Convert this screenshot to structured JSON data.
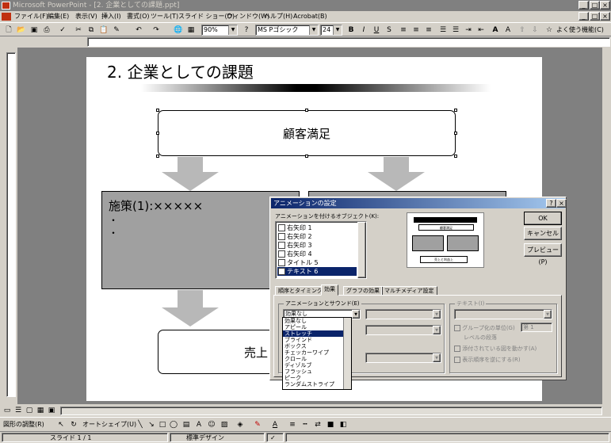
{
  "window": {
    "title": "Microsoft PowerPoint - [2. 企業としての課題.ppt]"
  },
  "menu": [
    "ファイル(F)",
    "編集(E)",
    "表示(V)",
    "挿入(I)",
    "書式(O)",
    "ツール(T)",
    "スライド ショー(D)",
    "ウィンドウ(W)",
    "ヘルプ(H)",
    "Acrobat(B)"
  ],
  "toolbar": {
    "zoom": "90%",
    "font": "MS Pゴシック",
    "font_size": "24",
    "bold": "B",
    "italic": "I",
    "underline": "U",
    "shadow": "S",
    "frequent": "よく使う機能(C)"
  },
  "slide": {
    "title": "2. 企業としての課題",
    "box_top": "顧客満足",
    "box_left": "施策(1):×××××",
    "bullets": [
      "・",
      "・"
    ],
    "box_bottom": "売上"
  },
  "dialog": {
    "title": "アニメーションの設定",
    "help": "?",
    "close": "×",
    "objects_label": "アニメーションを付けるオブジェクト(K):",
    "objects": [
      "右矢印 1",
      "右矢印 2",
      "右矢印 3",
      "右矢印 4",
      "タイトル 5",
      "テキスト 6"
    ],
    "preview_caption": "顧客満足",
    "preview_sub": "売上と利益上",
    "ok": "OK",
    "cancel": "キャンセル",
    "preview": "プレビュー(P)",
    "tabs": [
      "順序とタイミング",
      "効果",
      "グラフの効果",
      "マルチメディア設定"
    ],
    "group_anim": "アニメーションとサウンド(E)",
    "effect_value": "効果なし",
    "group_text": "テキスト(I)",
    "group_unit": "グループ化の単位(G)",
    "unit_value": "第 1",
    "level_label": "レベルの段落",
    "attach_shape": "添付されている図を動かす(A)",
    "reverse": "表示順序を逆にする(R)",
    "effects": [
      "効果なし",
      "アピール",
      "ストレッチ",
      "ブラインド",
      "ボックス",
      "チェッカーワイプ",
      "クロール",
      "ディゾルブ",
      "フラッシュ",
      "ピーク",
      "ランダムストライプ"
    ]
  },
  "drawbar": {
    "draw": "図形の調整(R)",
    "autoshape": "オートシェイプ(U)"
  },
  "status": {
    "slide": "スライド 1 / 1",
    "design": "標準デザイン"
  }
}
